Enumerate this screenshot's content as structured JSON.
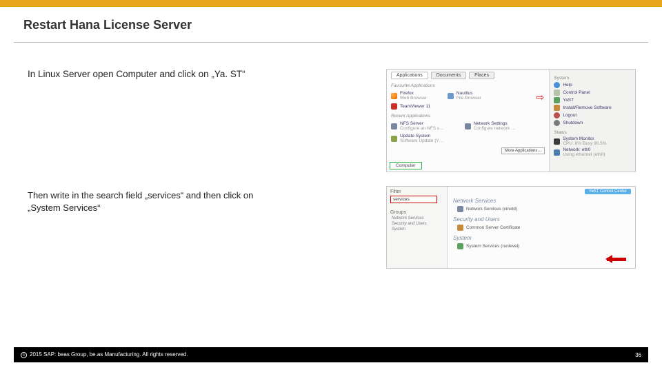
{
  "title": "Restart Hana License Server",
  "step1_text": "In Linux Server open Computer and click on „Ya. ST“",
  "step2_text_a": "Then write in the search field „services“ and then click on",
  "step2_text_b": "„System Services“",
  "fig1": {
    "tabs": {
      "applications": "Applications",
      "documents": "Documents",
      "places": "Places"
    },
    "fav_label": "Favourite Applications",
    "firefox": "Firefox",
    "firefox_sub": "Web Browser",
    "nautilus": "Nautilus",
    "nautilus_sub": "File Browser",
    "teamviewer": "TeamViewer 11",
    "recent_label": "Recent Applications",
    "nfs": "NFS Server",
    "nfs_sub": "Configure an NFS s…",
    "network": "Network Settings",
    "network_sub": "Configure network …",
    "update": "Update System",
    "update_sub": "Software Update (Y…",
    "more": "More Applications…",
    "computer": "Computer",
    "system_label": "System",
    "help": "Help",
    "cpanel": "Control Panel",
    "yast": "YaST",
    "install": "Install/Remove Software",
    "logout": "Logout",
    "shutdown": "Shutdown",
    "status_label": "Status",
    "sysmon": "System Monitor",
    "sysmon_sub": "CPU: 6% Busy 90.5%",
    "netstat": "Network: eth0",
    "netstat_sub": "Using ethernet (eth0)"
  },
  "fig2": {
    "titlebar": "YaST Control Center",
    "filter_label": "Filter",
    "filter_value": "services",
    "groups_label": "Groups",
    "g1": "Network Services",
    "g2": "Security and Users",
    "g3": "System",
    "cat1": "Network Services",
    "item1": "Network Services (xinetd)",
    "cat2": "Security and Users",
    "item2": "Common Server Certificate",
    "cat3": "System",
    "item3": "System Services (runlevel)"
  },
  "footer": {
    "copyright": "2015 SAP: beas Group, be.as Manufacturing.  All rights reserved.",
    "page": "36"
  }
}
